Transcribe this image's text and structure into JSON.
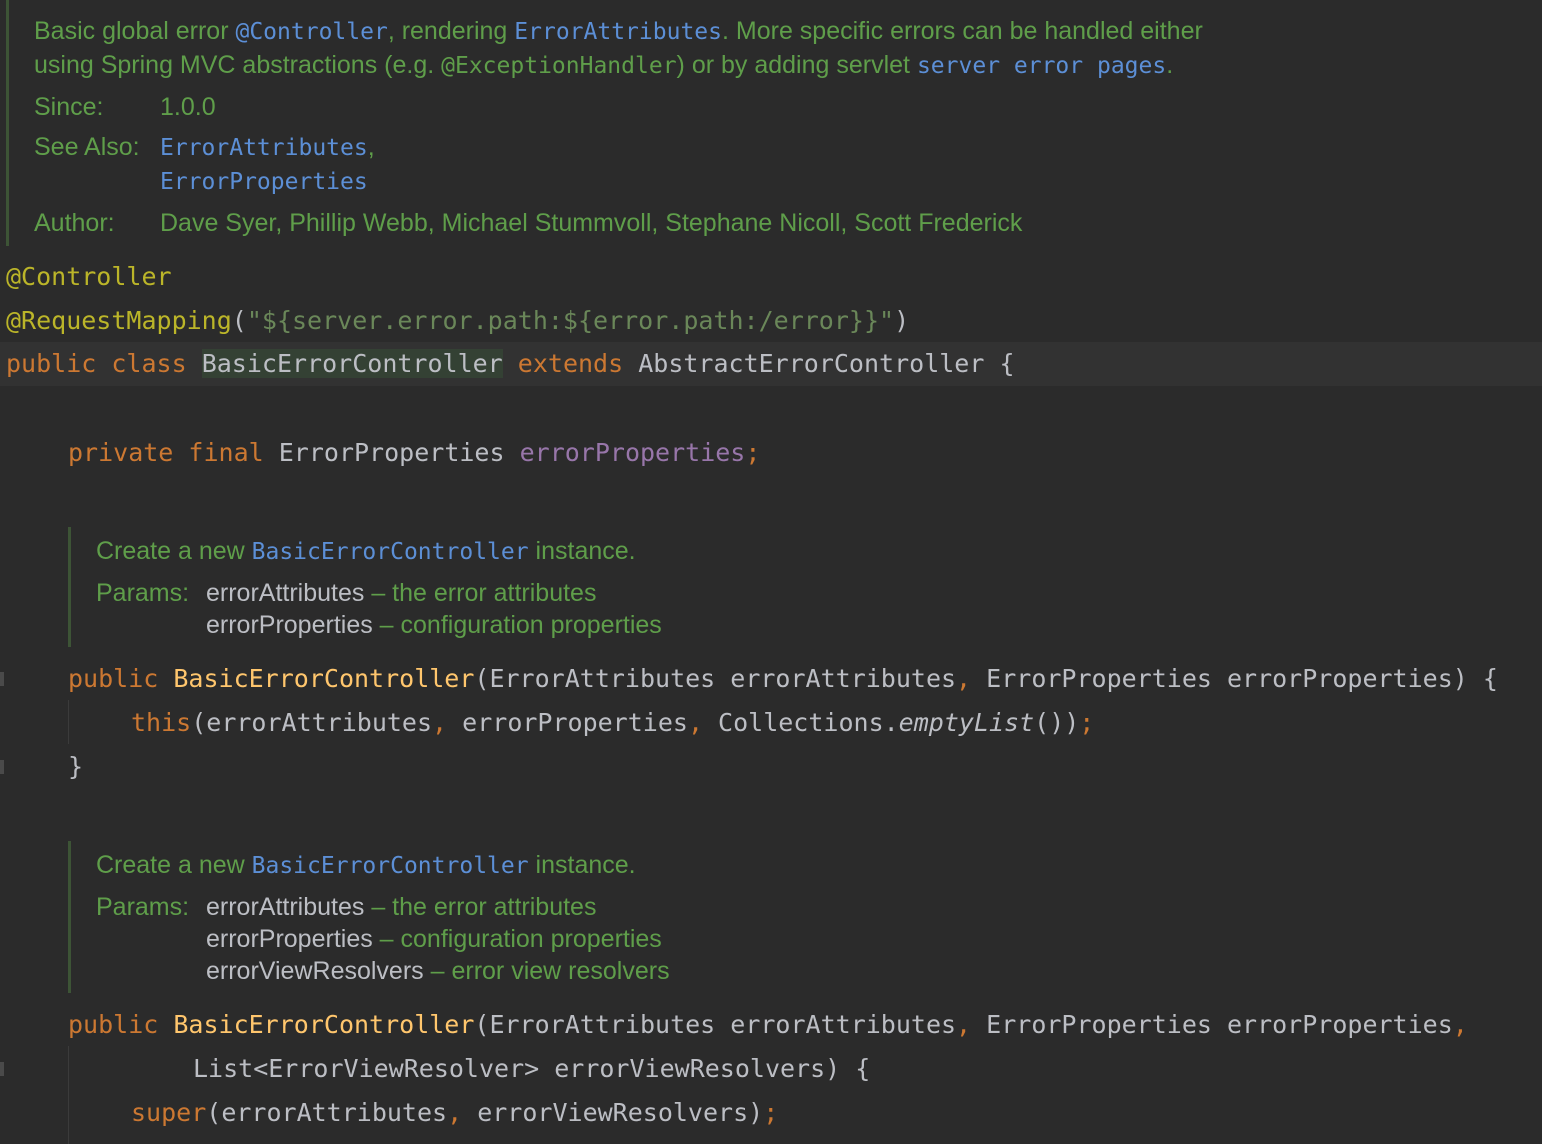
{
  "class_doc": {
    "line1_a": "Basic global error ",
    "line1_b": "@Controller",
    "line1_c": ", rendering ",
    "line1_d": "ErrorAttributes",
    "line1_e": ". More specific errors can be handled either",
    "line2_a": "using Spring MVC abstractions (e.g. ",
    "line2_b": "@ExceptionHandler",
    "line2_c": ") or by adding servlet ",
    "line2_d": "server error pages",
    "line2_e": ".",
    "since_label": "Since:",
    "since_value": "1.0.0",
    "see_also_label": "See Also:",
    "see_also_1": "ErrorAttributes",
    "see_also_1_sep": ",",
    "see_also_2": "ErrorProperties",
    "author_label": "Author:",
    "author_value": "Dave Syer, Phillip Webb, Michael Stummvoll, Stephane Nicoll, Scott Frederick"
  },
  "code": {
    "ann1": "@Controller",
    "ann2_name": "@RequestMapping",
    "ann2_open": "(",
    "ann2_str": "\"${server.error.path:${error.path:/error}}\"",
    "ann2_close": ")",
    "cls_public": "public",
    "cls_class": "class",
    "cls_name": "BasicErrorController",
    "cls_extends": "extends",
    "cls_parent": "AbstractErrorController",
    "cls_brace": "{",
    "fld_private": "private",
    "fld_final": "final",
    "fld_type": "ErrorProperties",
    "fld_name": "errorProperties",
    "fld_semi": ";",
    "c1_public": "public",
    "c1_name": "BasicErrorController",
    "c1_p1": "(ErrorAttributes errorAttributes",
    "c1_comma": ",",
    "c1_p2": " ErrorProperties errorProperties) ",
    "c1_arrow": "{",
    "c1b_this": "this",
    "c1b_a": "(errorAttributes",
    "c1b_c1": ",",
    "c1b_b": " errorProperties",
    "c1b_c2": ",",
    "c1b_c": " Collections.",
    "c1b_m": "emptyList",
    "c1b_d": "())",
    "c1b_semi": ";",
    "c1_end": "}",
    "c2_public": "public",
    "c2_name": "BasicErrorController",
    "c2_p1": "(ErrorAttributes errorAttributes",
    "c2_comma1": ",",
    "c2_p2": " ErrorProperties errorProperties",
    "c2_comma2": ",",
    "c2_l2": "List<ErrorViewResolver> errorViewResolvers) {",
    "c2b_super": "super",
    "c2b_a": "(errorAttributes",
    "c2b_c": ",",
    "c2b_b": " errorViewResolvers)",
    "c2b_semi": ";"
  },
  "ctor_doc_1": {
    "line1_a": "Create a new ",
    "line1_b": "BasicErrorController",
    "line1_c": " instance.",
    "params_label": "Params:",
    "p1_name": "errorAttributes",
    "p1_desc": " – the error attributes",
    "p2_name": "errorProperties",
    "p2_desc": " – configuration properties"
  },
  "ctor_doc_2": {
    "line1_a": "Create a new ",
    "line1_b": "BasicErrorController",
    "line1_c": " instance.",
    "params_label": "Params:",
    "p1_name": "errorAttributes",
    "p1_desc": " – the error attributes",
    "p2_name": "errorProperties",
    "p2_desc": " – configuration properties",
    "p3_name": "errorViewResolvers",
    "p3_desc": " – error view resolvers"
  }
}
